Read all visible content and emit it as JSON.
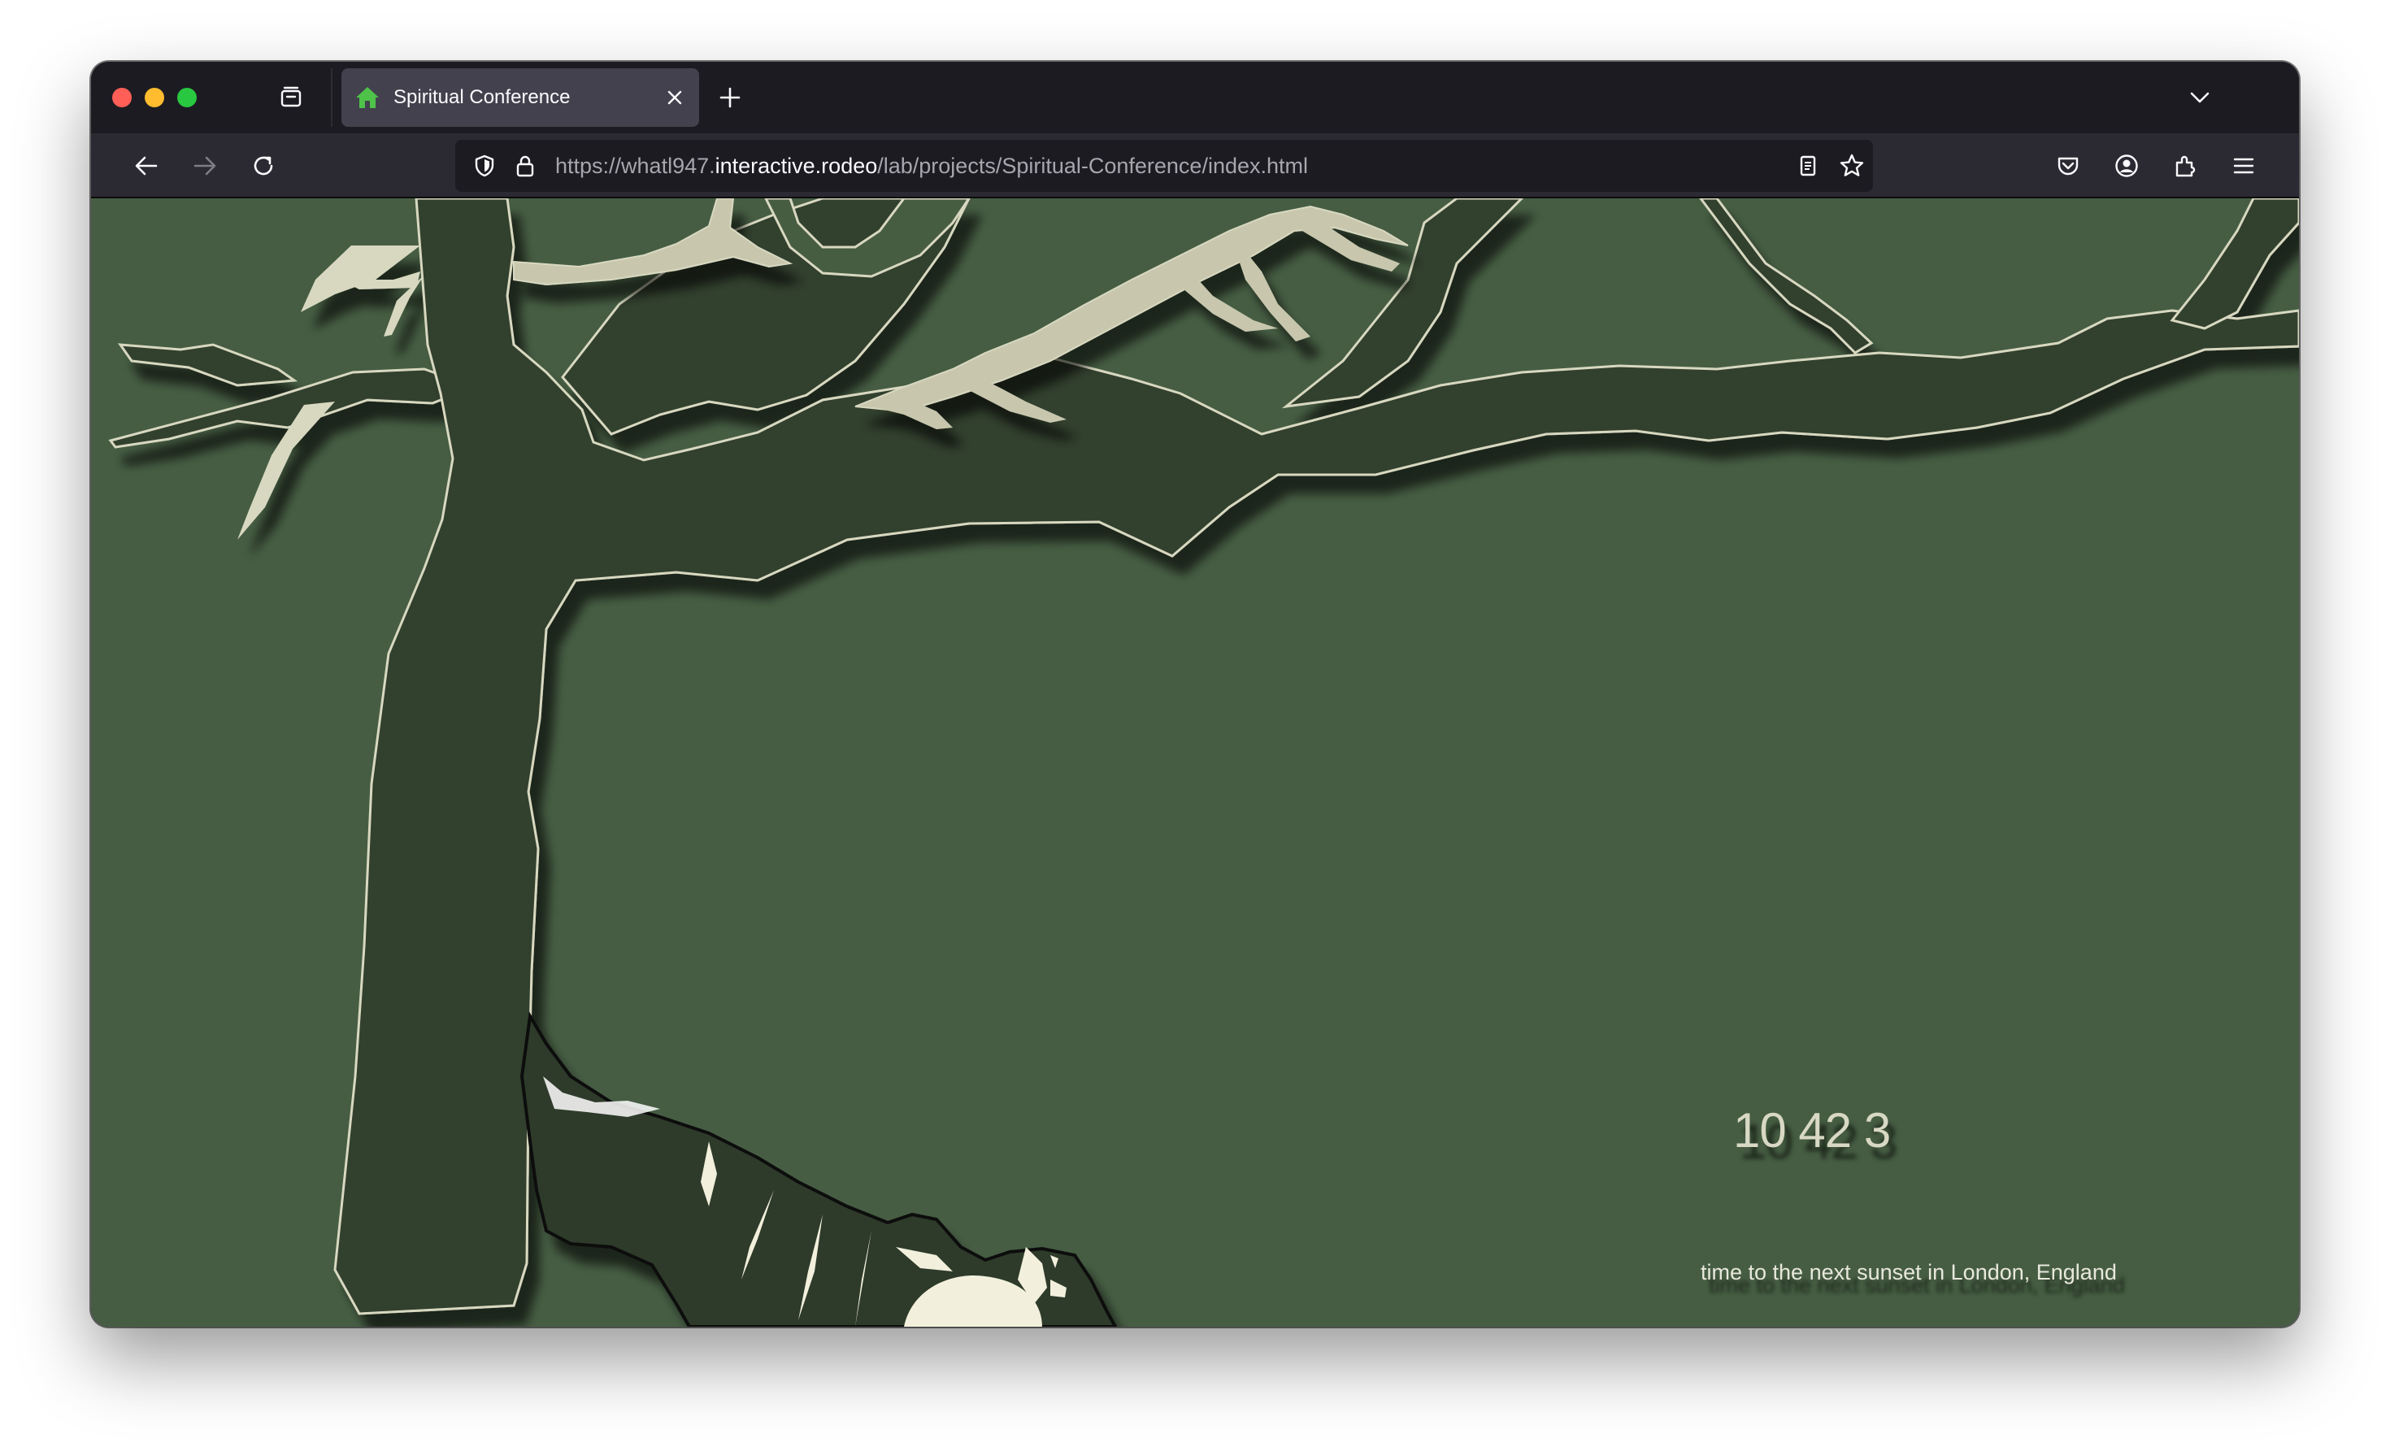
{
  "browser": {
    "tab": {
      "title": "Spiritual Conference",
      "favicon": "home-icon"
    },
    "url": {
      "prefix": "https://whatl947.",
      "host": "interactive.rodeo",
      "path": "/lab/projects/Spiritual-Conference/index.html"
    },
    "icons": {
      "tab_overview": "tab-overview-icon",
      "close_tab": "close-icon",
      "new_tab": "plus-icon",
      "tab_list": "chevron-down-icon",
      "back": "back-arrow-icon",
      "forward": "forward-arrow-icon",
      "reload": "reload-icon",
      "tracking_protection": "shield-icon",
      "security": "lock-icon",
      "reader_view": "reader-view-icon",
      "bookmark": "star-icon",
      "pocket": "pocket-icon",
      "account": "account-icon",
      "extensions": "extensions-icon",
      "menu": "hamburger-menu-icon"
    },
    "colors": {
      "chrome_dark": "#1c1b22",
      "toolbar": "#2b2a33",
      "active_tab": "#42414d",
      "favicon_green": "#4fc24a"
    }
  },
  "page": {
    "countdown": "10 42 3",
    "caption": "time to the next sunset in London, England",
    "colors": {
      "background": "#465d43",
      "tree_dark": "#333f2f",
      "branch_light": "#c8c7ae",
      "outline": "#d8d8c0",
      "moon": "#f2f0dc"
    }
  }
}
